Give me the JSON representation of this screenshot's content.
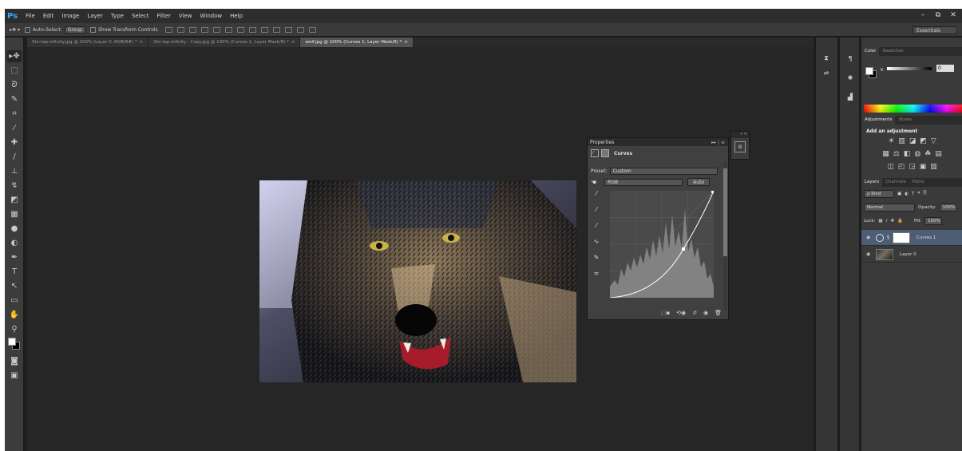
{
  "app": {
    "logo": "Ps",
    "menu": [
      "File",
      "Edit",
      "Image",
      "Layer",
      "Type",
      "Select",
      "Filter",
      "View",
      "Window",
      "Help"
    ],
    "window_controls": [
      "–",
      "⧉",
      "✕"
    ]
  },
  "options_bar": {
    "auto_select_label": "Auto-Select:",
    "auto_select_value": "Group",
    "show_transform_label": "Show Transform Controls",
    "workspace": "Essentials"
  },
  "tabs": [
    {
      "label": "Sto-tap-infinity.jpg @ 200% (Layer 0, RGB/8#) *",
      "active": false
    },
    {
      "label": "Sto-tap-infinity - Copy.jpg @ 100% (Curves 1, Layer Mask/8) *",
      "active": false
    },
    {
      "label": "wolf.jpg @ 100% (Curves 1, Layer Mask/8) *",
      "active": true
    }
  ],
  "properties": {
    "tab_label": "Properties",
    "panel_title": "Curves",
    "preset_label": "Preset:",
    "preset_value": "Custom",
    "channel_value": "RGB",
    "auto_label": "Auto"
  },
  "right_panels": {
    "color_tabs": [
      "Color",
      "Swatches"
    ],
    "k_label": "K",
    "k_value": "0",
    "adjust_tabs": [
      "Adjustments",
      "Styles"
    ],
    "add_adjustment": "Add an adjustment",
    "layers_tabs": [
      "Layers",
      "Channels",
      "Paths"
    ],
    "kind_label": "ρ Kind",
    "blend_mode": "Normal",
    "opacity_label": "Opacity:",
    "opacity_value": "100%",
    "lock_label": "Lock:",
    "fill_label": "Fill:",
    "fill_value": "100%",
    "layers": [
      {
        "name": "Curves 1",
        "selected": true
      },
      {
        "name": "Layer 0",
        "selected": false
      }
    ]
  },
  "colors": {
    "foreground": "#ffffff",
    "background": "#000000",
    "accent": "#31a8ff",
    "selection": "#4d5e74"
  }
}
